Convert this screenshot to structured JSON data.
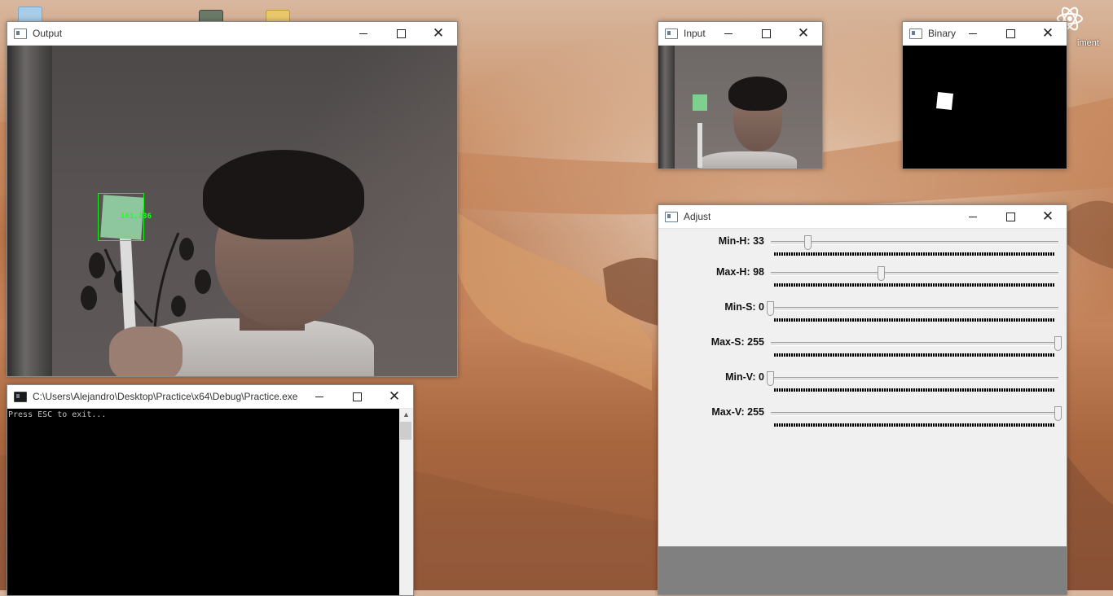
{
  "desktop": {
    "icons": [
      {
        "name": "recycle-bin-icon",
        "color": "#9fc7e8"
      },
      {
        "name": "video-file-icon",
        "color": "#6b7a66"
      },
      {
        "name": "folder-icon",
        "color": "#e8c86a"
      }
    ],
    "right_icon_label": "iment"
  },
  "windows": {
    "output": {
      "title": "Output",
      "tracking_label": "161,236",
      "accent": "#14f014"
    },
    "input": {
      "title": "Input"
    },
    "binary": {
      "title": "Binary"
    },
    "console": {
      "title": "C:\\Users\\Alejandro\\Desktop\\Practice\\x64\\Debug\\Practice.exe",
      "lines": [
        "Press ESC to exit..."
      ]
    },
    "adjust": {
      "title": "Adjust",
      "trackbars": [
        {
          "label": "Min-H: 33",
          "value": 33,
          "max": 255
        },
        {
          "label": "Max-H: 98",
          "value": 98,
          "max": 255
        },
        {
          "label": "Min-S: 0",
          "value": 0,
          "max": 255
        },
        {
          "label": "Max-S: 255",
          "value": 255,
          "max": 255
        },
        {
          "label": "Min-V: 0",
          "value": 0,
          "max": 255
        },
        {
          "label": "Max-V: 255",
          "value": 255,
          "max": 255
        }
      ]
    }
  },
  "controls": {
    "minimize": "—",
    "maximize": "☐",
    "close": "✕"
  }
}
